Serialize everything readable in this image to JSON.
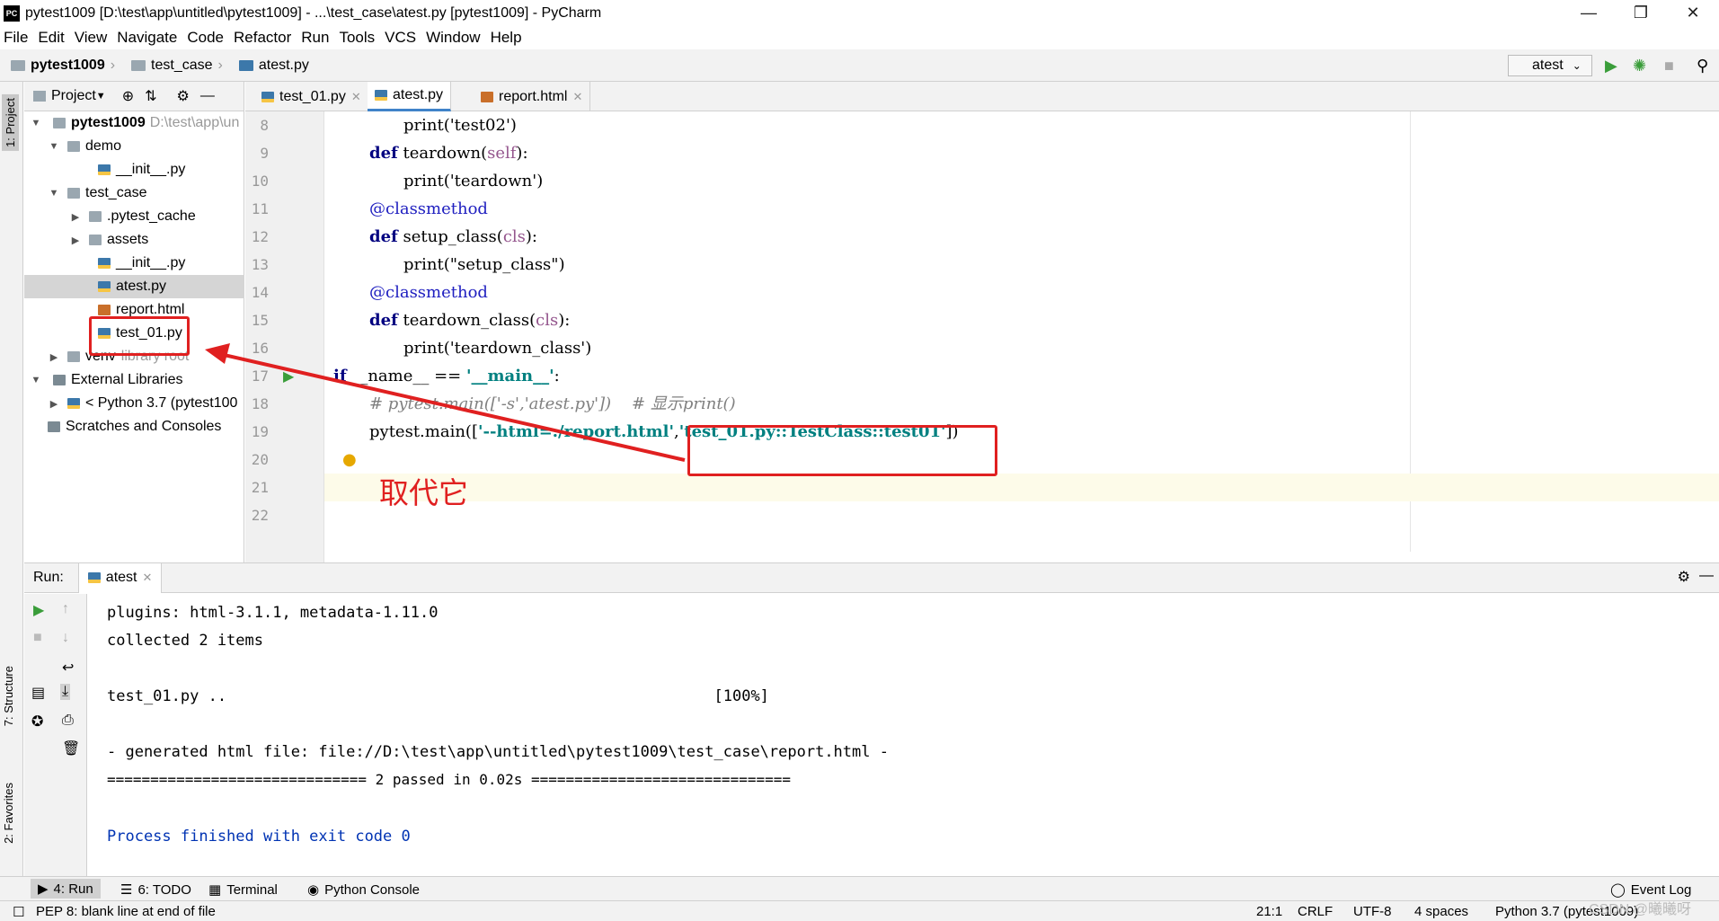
{
  "window": {
    "title": "pytest1009 [D:\\test\\app\\untitled\\pytest1009] - ...\\test_case\\atest.py [pytest1009] - PyCharm",
    "app_icon": "PC"
  },
  "menu": [
    "File",
    "Edit",
    "View",
    "Navigate",
    "Code",
    "Refactor",
    "Run",
    "Tools",
    "VCS",
    "Window",
    "Help"
  ],
  "breadcrumbs": [
    "pytest1009",
    "test_case",
    "atest.py"
  ],
  "run_config": "atest",
  "left_tabs": {
    "project": "1: Project",
    "structure": "7: Structure",
    "favorites": "2: Favorites"
  },
  "project": {
    "header": "Project",
    "tree": [
      {
        "name": "pytest1009",
        "extra": "D:\\test\\app\\un",
        "bold": true
      },
      {
        "name": "demo"
      },
      {
        "name": "__init__.py"
      },
      {
        "name": "test_case"
      },
      {
        "name": ".pytest_cache"
      },
      {
        "name": "assets"
      },
      {
        "name": "__init__.py"
      },
      {
        "name": "atest.py"
      },
      {
        "name": "report.html"
      },
      {
        "name": "test_01.py"
      },
      {
        "name": "venv",
        "extra": "library root"
      },
      {
        "name": "External Libraries"
      },
      {
        "name": "< Python 3.7 (pytest100"
      },
      {
        "name": "Scratches and Consoles"
      }
    ]
  },
  "editor": {
    "tabs": [
      "test_01.py",
      "atest.py",
      "report.html"
    ],
    "active_tab": "atest.py",
    "lines": [
      {
        "n": "8"
      },
      {
        "n": "9"
      },
      {
        "n": "10"
      },
      {
        "n": "11"
      },
      {
        "n": "12"
      },
      {
        "n": "13"
      },
      {
        "n": "14"
      },
      {
        "n": "15"
      },
      {
        "n": "16"
      },
      {
        "n": "17"
      },
      {
        "n": "18"
      },
      {
        "n": "19"
      },
      {
        "n": "20"
      },
      {
        "n": "21"
      },
      {
        "n": "22"
      }
    ],
    "code": {
      "l8": "print('test02')",
      "l9_kw": "def",
      "l9_fn": " teardown(",
      "l9_self": "self",
      "l9_end": "):",
      "l10": "print('teardown')",
      "l11": "@classmethod",
      "l12_kw": "def",
      "l12_fn": " setup_class(",
      "l12_cls": "cls",
      "l12_end": "):",
      "l13": "print(\"setup_class\")",
      "l14": "@classmethod",
      "l15_kw": "def",
      "l15_fn": " teardown_class(",
      "l15_cls": "cls",
      "l15_end": "):",
      "l16": "print('teardown_class')",
      "l17_kw": "if",
      "l17_mid": " __name__ == ",
      "l17_str": "'__main__'",
      "l17_end": ":",
      "l18": "# pytest.main(['-s','atest.py'])    # 显示print()",
      "l19_a": "pytest.main([",
      "l19_b": "'--html=./report.html'",
      "l19_c": ",",
      "l19_d": "'test_01.py::TestClass::test01'",
      "l19_e": "])"
    }
  },
  "annotation": {
    "text": "取代它"
  },
  "run": {
    "label": "Run:",
    "tab": "atest",
    "output": [
      "plugins: html-3.1.1, metadata-1.11.0",
      "collected 2 items",
      "",
      "test_01.py ..                                                     [100%]",
      "",
      "- generated html file: file://D:\\test\\app\\untitled\\pytest1009\\test_case\\report.html -",
      "============================== 2 passed in 0.02s =============================="
    ],
    "finish": "Process finished with exit code 0"
  },
  "bottom_tabs": [
    "4: Run",
    "6: TODO",
    "Terminal",
    "Python Console"
  ],
  "event_log": "Event Log",
  "status": {
    "message": "PEP 8: blank line at end of file",
    "position": "21:1",
    "line_sep": "CRLF",
    "encoding": "UTF-8",
    "indent": "4 spaces",
    "interpreter": "Python 3.7 (pytest1009)"
  },
  "watermark": "CSDN @曦曦呀",
  "colors": {
    "accent": "#4083c9",
    "annotation_red": "#e02020",
    "run_green": "#3a9d3a"
  }
}
